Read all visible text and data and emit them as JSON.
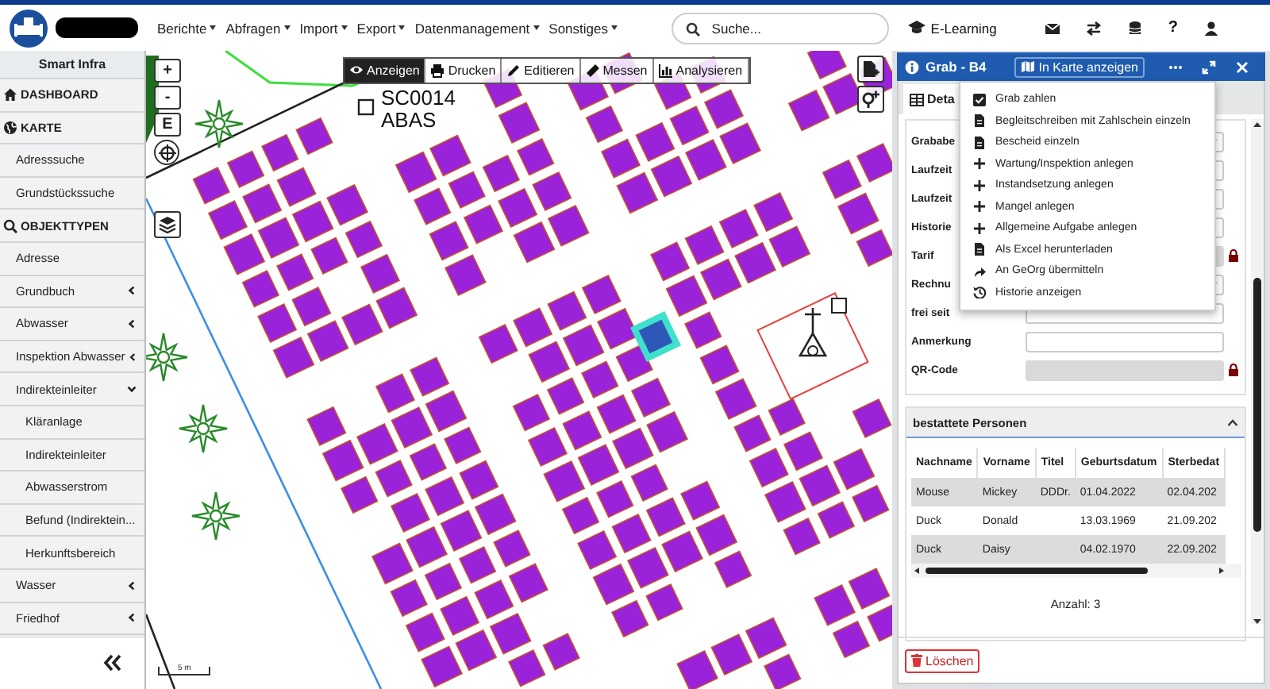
{
  "topbar": {
    "menu": [
      {
        "label": "Berichte"
      },
      {
        "label": "Abfragen"
      },
      {
        "label": "Import"
      },
      {
        "label": "Export"
      },
      {
        "label": "Datenmanagement"
      },
      {
        "label": "Sonstiges"
      }
    ],
    "search": {
      "placeholder": "Suche..."
    },
    "elearning": "E-Learning",
    "help": "?"
  },
  "sidebar": {
    "title": "Smart Infra",
    "items": [
      {
        "kind": "section",
        "label": "DASHBOARD"
      },
      {
        "kind": "section",
        "label": "KARTE"
      },
      {
        "kind": "link",
        "label": "Adresssuche"
      },
      {
        "kind": "link",
        "label": "Grundstückssuche"
      },
      {
        "kind": "section",
        "label": "OBJEKTTYPEN"
      },
      {
        "kind": "link",
        "label": "Adresse"
      },
      {
        "kind": "group",
        "label": "Grundbuch",
        "expanded": false
      },
      {
        "kind": "group",
        "label": "Abwasser",
        "expanded": false
      },
      {
        "kind": "group",
        "label": "Inspektion Abwasser",
        "expanded": false
      },
      {
        "kind": "group",
        "label": "Indirekteinleiter",
        "expanded": true,
        "children": [
          {
            "label": "Kläranlage"
          },
          {
            "label": "Indirekteinleiter"
          },
          {
            "label": "Abwasserstrom"
          },
          {
            "label": "Befund (Indirektein..."
          },
          {
            "label": "Herkunftsbereich"
          }
        ]
      },
      {
        "kind": "group",
        "label": "Wasser",
        "expanded": false
      },
      {
        "kind": "group",
        "label": "Friedhof",
        "expanded": false
      }
    ]
  },
  "map": {
    "toolbar": [
      {
        "label": "Anzeigen",
        "selected": true
      },
      {
        "label": "Drucken",
        "selected": false
      },
      {
        "label": "Editieren",
        "selected": false
      },
      {
        "label": "Messen",
        "selected": false
      },
      {
        "label": "Analysieren",
        "selected": false
      }
    ],
    "zoom_controls": [
      "+",
      "-",
      "E"
    ],
    "labels": [
      "SC0014",
      "ABAS"
    ],
    "scale": "5 m"
  },
  "panel": {
    "title": "Grab - B4",
    "map_button": "In Karte anzeigen",
    "tabs": [
      {
        "label": "Deta",
        "selected": true
      }
    ],
    "fields": [
      {
        "label": "Grababe",
        "kind": "select"
      },
      {
        "label": "Laufzeit",
        "kind": "text"
      },
      {
        "label": "Laufzeit",
        "kind": "text"
      },
      {
        "label": "Historie",
        "kind": "text"
      },
      {
        "label": "Tarif",
        "kind": "locked"
      },
      {
        "label": "Rechnu",
        "kind": "select"
      },
      {
        "label": "frei seit",
        "kind": "text"
      },
      {
        "label": "Anmerkung",
        "kind": "text"
      },
      {
        "label": "QR-Code",
        "kind": "locked"
      }
    ],
    "menu": [
      {
        "label": "Grab zahlen",
        "kind": "check"
      },
      {
        "label": "Begleitschreiben mit Zahlschein einzeln",
        "kind": "doc"
      },
      {
        "label": "Bescheid einzeln",
        "kind": "doc"
      },
      {
        "label": "Wartung/Inspektion anlegen",
        "kind": "plus"
      },
      {
        "label": "Instandsetzung anlegen",
        "kind": "plus"
      },
      {
        "label": "Mangel anlegen",
        "kind": "plus"
      },
      {
        "label": "Allgemeine Aufgabe anlegen",
        "kind": "plus"
      },
      {
        "label": "Als Excel herunterladen",
        "kind": "doc"
      },
      {
        "label": "An GeOrg übermitteln",
        "kind": "share"
      },
      {
        "label": "Historie anzeigen",
        "kind": "history"
      }
    ],
    "section": {
      "title": "bestattete Personen",
      "expanded": true,
      "columns": [
        "Nachname",
        "Vorname",
        "Titel",
        "Geburtsdatum",
        "Sterbedat"
      ],
      "rows": [
        [
          "Mouse",
          "Mickey",
          "DDDr.",
          "01.04.2022",
          "02.04.202"
        ],
        [
          "Duck",
          "Donald",
          "",
          "13.03.1969",
          "21.09.202"
        ],
        [
          "Duck",
          "Daisy",
          "",
          "04.02.1970",
          "22.09.202"
        ]
      ],
      "count": "Anzahl: 3"
    },
    "delete_button": "Löschen"
  }
}
